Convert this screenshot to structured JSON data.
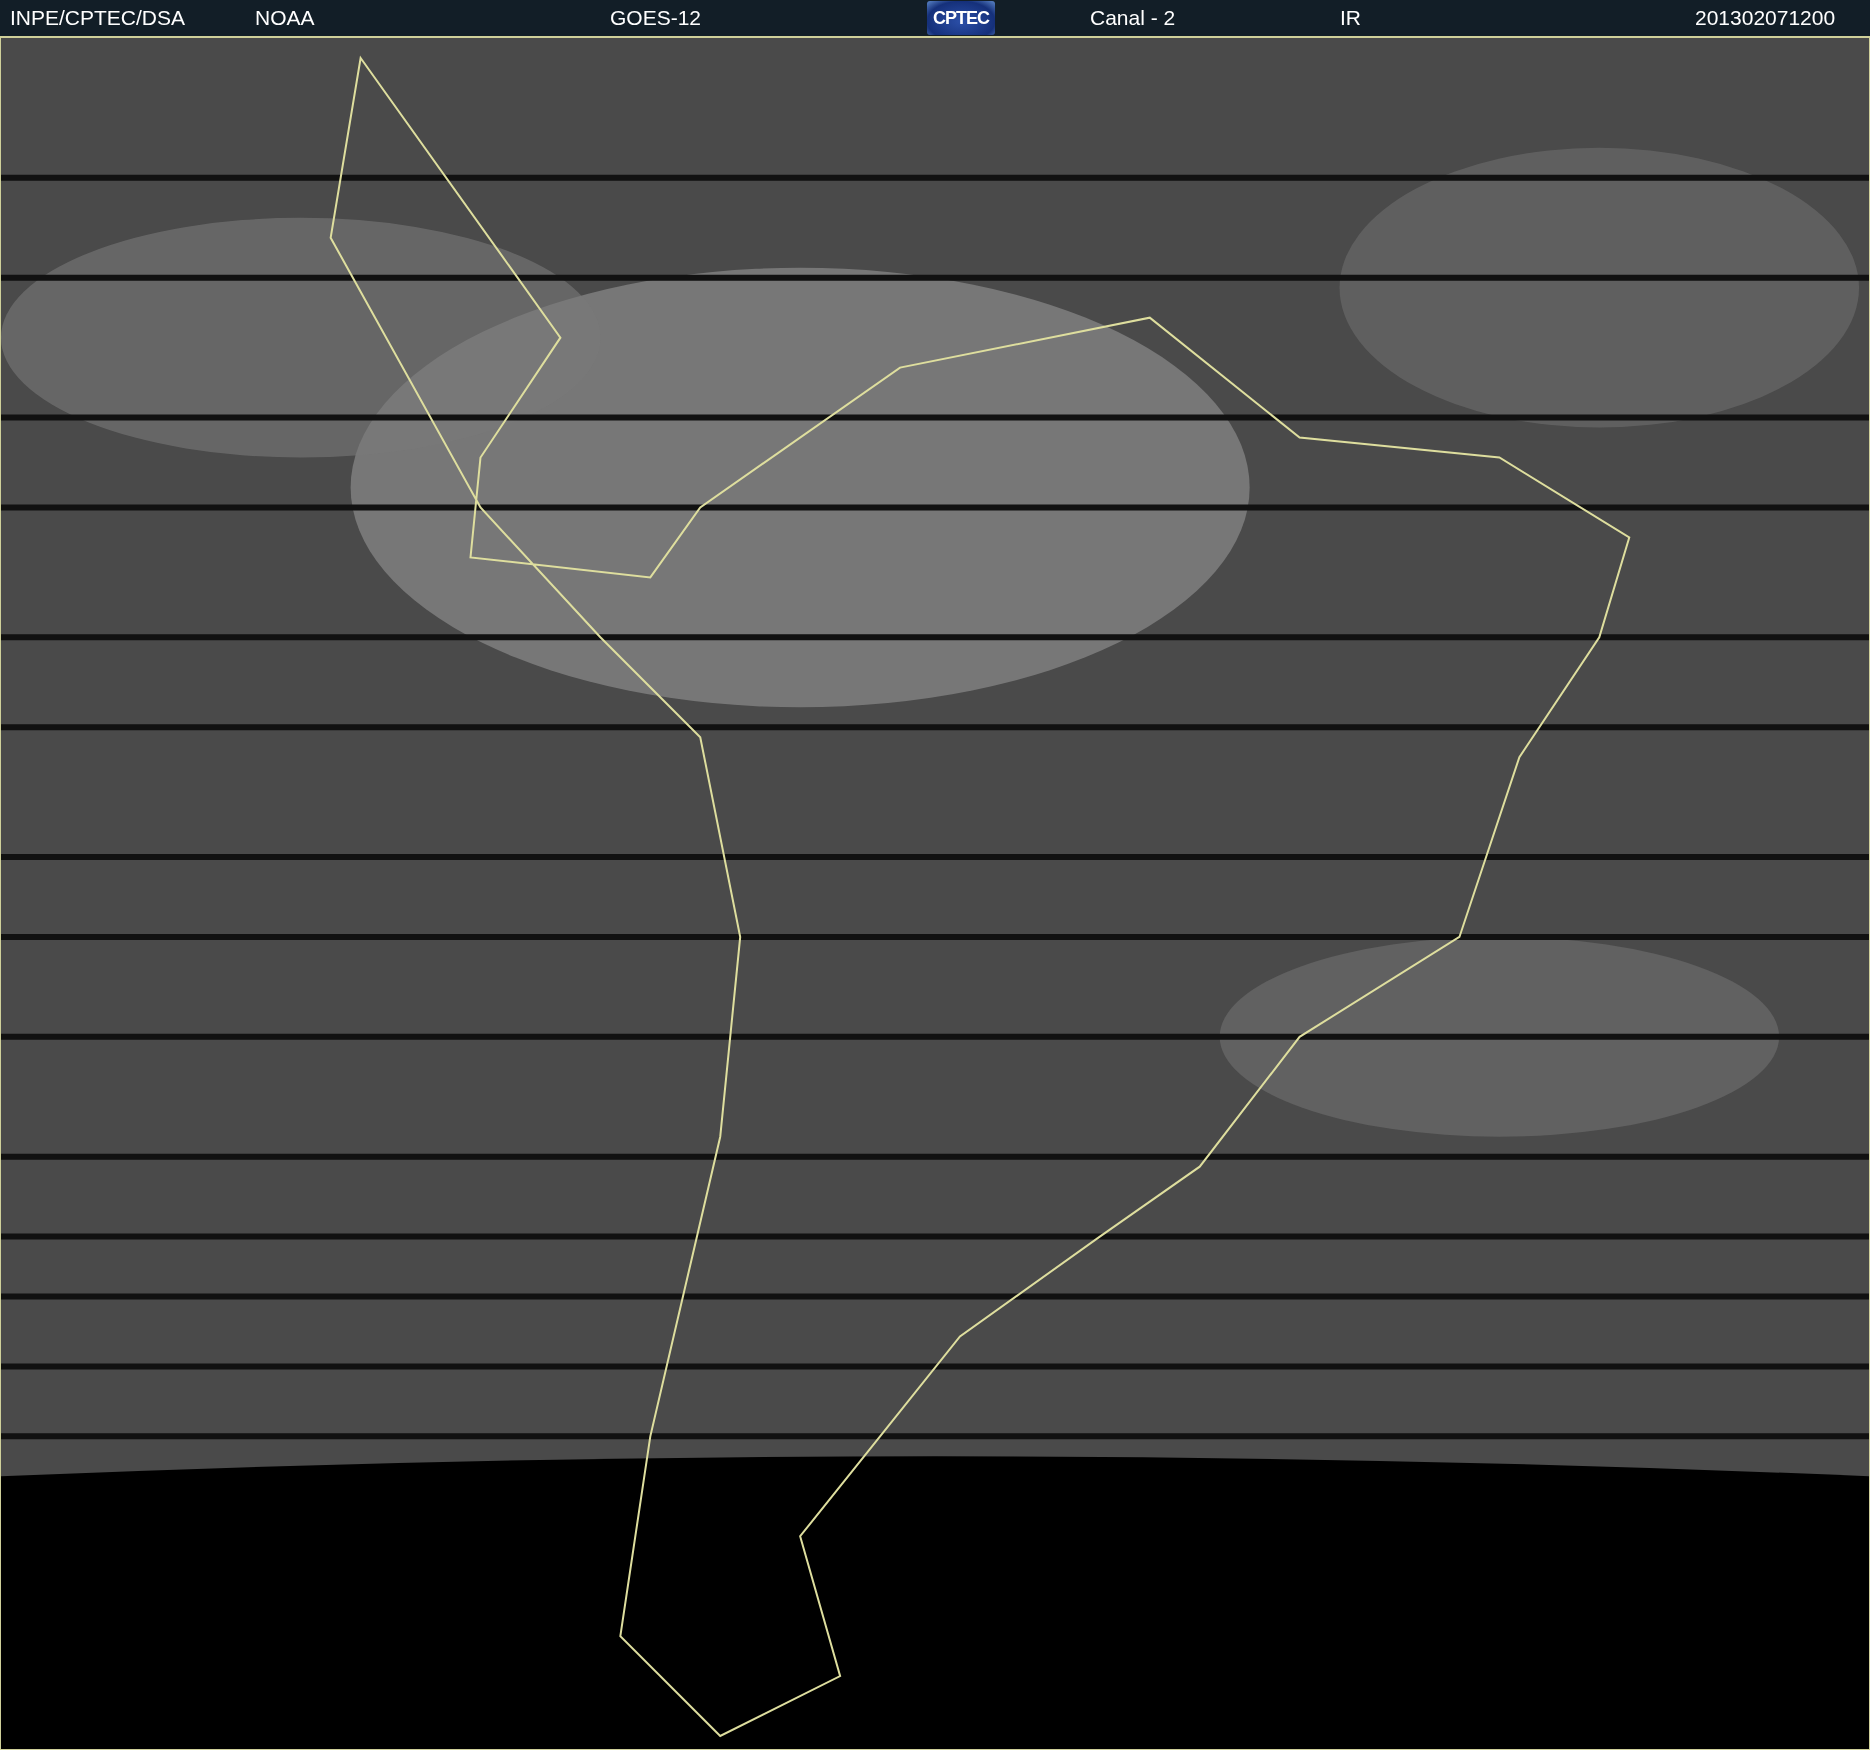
{
  "header": {
    "items": [
      {
        "kind": "text",
        "text": "INPE/CPTEC/DSA"
      },
      {
        "kind": "text",
        "text": "NOAA"
      },
      {
        "kind": "text",
        "text": "GOES-12"
      },
      {
        "kind": "logo",
        "text": "CPTEC"
      },
      {
        "kind": "text",
        "text": "Canal - 2"
      },
      {
        "kind": "text",
        "text": "IR"
      },
      {
        "kind": "text",
        "text": "201302071200"
      }
    ]
  }
}
